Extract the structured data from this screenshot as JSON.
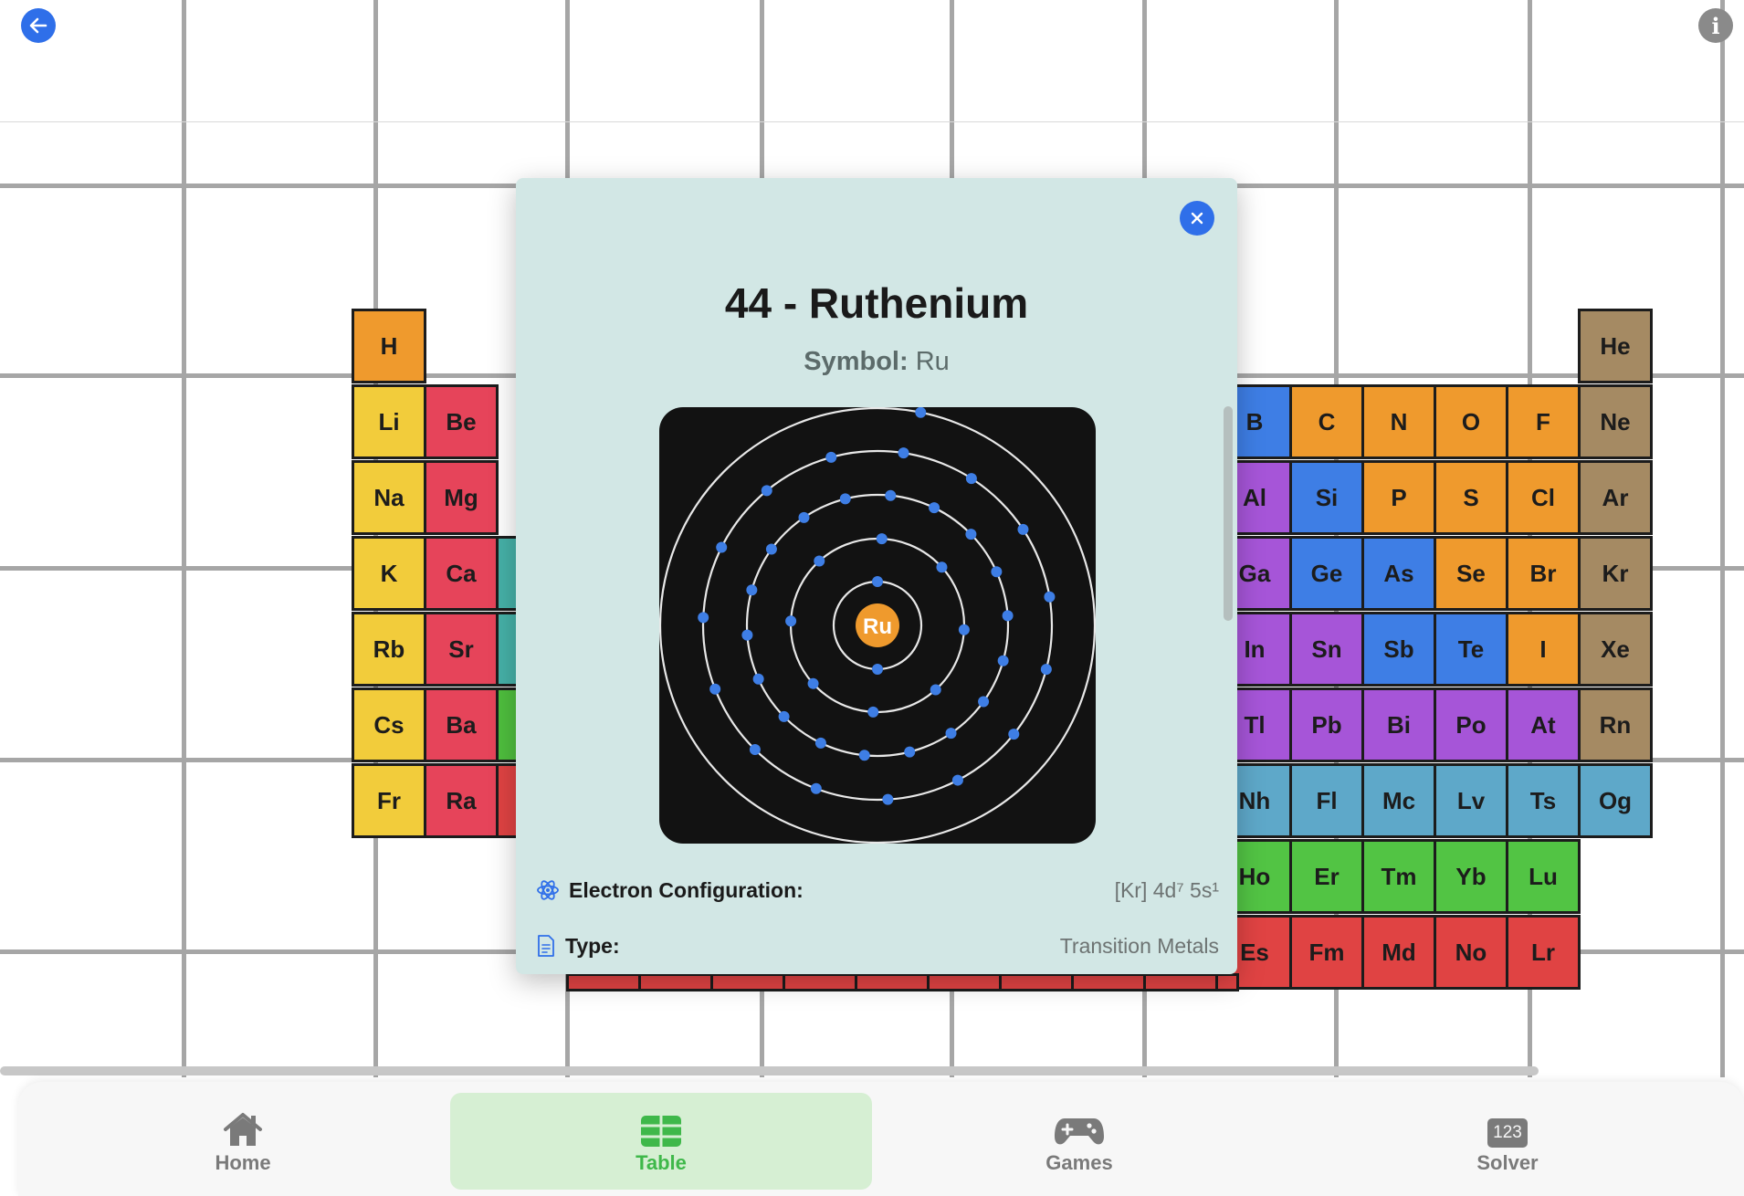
{
  "header": {
    "back_icon": "arrow-left-icon",
    "info_icon": "info-icon",
    "info_glyph": "i"
  },
  "table": {
    "cells": [
      {
        "sym": "H",
        "color": "#ef9a2d",
        "col": 1,
        "row": 1
      },
      {
        "sym": "He",
        "color": "#a58a63",
        "col": 18,
        "row": 1
      },
      {
        "sym": "Li",
        "color": "#f2cc3b",
        "col": 1,
        "row": 2
      },
      {
        "sym": "Be",
        "color": "#e6445a",
        "col": 2,
        "row": 2
      },
      {
        "sym": "B",
        "color": "#3e7ee5",
        "col": 13,
        "row": 2
      },
      {
        "sym": "C",
        "color": "#ef9a2d",
        "col": 14,
        "row": 2
      },
      {
        "sym": "N",
        "color": "#ef9a2d",
        "col": 15,
        "row": 2
      },
      {
        "sym": "O",
        "color": "#ef9a2d",
        "col": 16,
        "row": 2
      },
      {
        "sym": "F",
        "color": "#ef9a2d",
        "col": 17,
        "row": 2
      },
      {
        "sym": "Ne",
        "color": "#a58a63",
        "col": 18,
        "row": 2
      },
      {
        "sym": "Na",
        "color": "#f2cc3b",
        "col": 1,
        "row": 3
      },
      {
        "sym": "Mg",
        "color": "#e6445a",
        "col": 2,
        "row": 3
      },
      {
        "sym": "Al",
        "color": "#a655d8",
        "col": 13,
        "row": 3
      },
      {
        "sym": "Si",
        "color": "#3e7ee5",
        "col": 14,
        "row": 3
      },
      {
        "sym": "P",
        "color": "#ef9a2d",
        "col": 15,
        "row": 3
      },
      {
        "sym": "S",
        "color": "#ef9a2d",
        "col": 16,
        "row": 3
      },
      {
        "sym": "Cl",
        "color": "#ef9a2d",
        "col": 17,
        "row": 3
      },
      {
        "sym": "Ar",
        "color": "#a58a63",
        "col": 18,
        "row": 3
      },
      {
        "sym": "K",
        "color": "#f2cc3b",
        "col": 1,
        "row": 4
      },
      {
        "sym": "Ca",
        "color": "#e6445a",
        "col": 2,
        "row": 4
      },
      {
        "sym": "Ga",
        "color": "#a655d8",
        "col": 13,
        "row": 4
      },
      {
        "sym": "Ge",
        "color": "#3e7ee5",
        "col": 14,
        "row": 4
      },
      {
        "sym": "As",
        "color": "#3e7ee5",
        "col": 15,
        "row": 4
      },
      {
        "sym": "Se",
        "color": "#ef9a2d",
        "col": 16,
        "row": 4
      },
      {
        "sym": "Br",
        "color": "#ef9a2d",
        "col": 17,
        "row": 4
      },
      {
        "sym": "Kr",
        "color": "#a58a63",
        "col": 18,
        "row": 4
      },
      {
        "sym": "Rb",
        "color": "#f2cc3b",
        "col": 1,
        "row": 5
      },
      {
        "sym": "Sr",
        "color": "#e6445a",
        "col": 2,
        "row": 5
      },
      {
        "sym": "In",
        "color": "#a655d8",
        "col": 13,
        "row": 5
      },
      {
        "sym": "Sn",
        "color": "#a655d8",
        "col": 14,
        "row": 5
      },
      {
        "sym": "Sb",
        "color": "#3e7ee5",
        "col": 15,
        "row": 5
      },
      {
        "sym": "Te",
        "color": "#3e7ee5",
        "col": 16,
        "row": 5
      },
      {
        "sym": "I",
        "color": "#ef9a2d",
        "col": 17,
        "row": 5
      },
      {
        "sym": "Xe",
        "color": "#a58a63",
        "col": 18,
        "row": 5
      },
      {
        "sym": "Cs",
        "color": "#f2cc3b",
        "col": 1,
        "row": 6
      },
      {
        "sym": "Ba",
        "color": "#e6445a",
        "col": 2,
        "row": 6
      },
      {
        "sym": "Tl",
        "color": "#a655d8",
        "col": 13,
        "row": 6
      },
      {
        "sym": "Pb",
        "color": "#a655d8",
        "col": 14,
        "row": 6
      },
      {
        "sym": "Bi",
        "color": "#a655d8",
        "col": 15,
        "row": 6
      },
      {
        "sym": "Po",
        "color": "#a655d8",
        "col": 16,
        "row": 6
      },
      {
        "sym": "At",
        "color": "#a655d8",
        "col": 17,
        "row": 6
      },
      {
        "sym": "Rn",
        "color": "#a58a63",
        "col": 18,
        "row": 6
      },
      {
        "sym": "Fr",
        "color": "#f2cc3b",
        "col": 1,
        "row": 7
      },
      {
        "sym": "Ra",
        "color": "#e6445a",
        "col": 2,
        "row": 7
      },
      {
        "sym": "Nh",
        "color": "#5ea8c9",
        "col": 13,
        "row": 7
      },
      {
        "sym": "Fl",
        "color": "#5ea8c9",
        "col": 14,
        "row": 7
      },
      {
        "sym": "Mc",
        "color": "#5ea8c9",
        "col": 15,
        "row": 7
      },
      {
        "sym": "Lv",
        "color": "#5ea8c9",
        "col": 16,
        "row": 7
      },
      {
        "sym": "Ts",
        "color": "#5ea8c9",
        "col": 17,
        "row": 7
      },
      {
        "sym": "Og",
        "color": "#5ea8c9",
        "col": 18,
        "row": 7
      },
      {
        "sym": "Ho",
        "color": "#52c444",
        "col": 13,
        "row": 8
      },
      {
        "sym": "Er",
        "color": "#52c444",
        "col": 14,
        "row": 8
      },
      {
        "sym": "Tm",
        "color": "#52c444",
        "col": 15,
        "row": 8
      },
      {
        "sym": "Yb",
        "color": "#52c444",
        "col": 16,
        "row": 8
      },
      {
        "sym": "Lu",
        "color": "#52c444",
        "col": 17,
        "row": 8
      },
      {
        "sym": "Es",
        "color": "#e04343",
        "col": 13,
        "row": 9
      },
      {
        "sym": "Fm",
        "color": "#e04343",
        "col": 14,
        "row": 9
      },
      {
        "sym": "Md",
        "color": "#e04343",
        "col": 15,
        "row": 9
      },
      {
        "sym": "No",
        "color": "#e04343",
        "col": 16,
        "row": 9
      },
      {
        "sym": "Lr",
        "color": "#e04343",
        "col": 17,
        "row": 9
      },
      {
        "sym": "",
        "color": "#46b1a8",
        "col": 3,
        "row": 4
      },
      {
        "sym": "",
        "color": "#46b1a8",
        "col": 3,
        "row": 5
      },
      {
        "sym": "",
        "color": "#4fbf3e",
        "col": 3,
        "row": 6
      },
      {
        "sym": "",
        "color": "#e04343",
        "col": 3,
        "row": 7
      }
    ]
  },
  "modal": {
    "close_icon": "close-icon",
    "title": "44 - Ruthenium",
    "symbol_label": "Symbol:",
    "symbol_value": "Ru",
    "atom": {
      "nucleus_label": "Ru",
      "shell_electrons": [
        2,
        8,
        18,
        15,
        1
      ],
      "nucleus_color": "#ef9a2d",
      "electron_color": "#3e7ee5"
    },
    "details": [
      {
        "icon": "atom-icon",
        "label": "Electron Configuration:",
        "value": "[Kr] 4d⁷ 5s¹"
      },
      {
        "icon": "document-icon",
        "label": "Type:",
        "value": "Transition Metals"
      }
    ]
  },
  "tabbar": {
    "tabs": [
      {
        "label": "Home",
        "icon": "house-icon",
        "active": false
      },
      {
        "label": "Table",
        "icon": "table-icon",
        "active": true
      },
      {
        "label": "Games",
        "icon": "gamecontroller-icon",
        "active": false
      },
      {
        "label": "Solver",
        "icon": "123-icon",
        "icon_text": "123",
        "active": false
      }
    ]
  }
}
